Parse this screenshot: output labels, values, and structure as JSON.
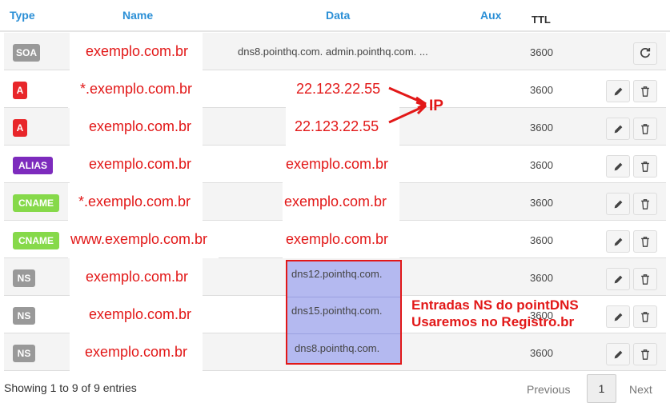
{
  "headers": {
    "type": "Type",
    "name": "Name",
    "data": "Data",
    "aux": "Aux",
    "ttl": "TTL"
  },
  "rows": [
    {
      "type": "SOA",
      "name": "exemplo.com.br",
      "data": "dns8.pointhq.com. admin.pointhq.com. ...",
      "ttl": "3600"
    },
    {
      "type": "A",
      "name": "*.exemplo.com.br",
      "data": "22.123.22.55",
      "ttl": "3600"
    },
    {
      "type": "A",
      "name": "exemplo.com.br",
      "data": "22.123.22.55",
      "ttl": "3600"
    },
    {
      "type": "ALIAS",
      "name": "exemplo.com.br",
      "data": "exemplo.com.br",
      "ttl": "3600"
    },
    {
      "type": "CNAME",
      "name": "*.exemplo.com.br",
      "data": "exemplo.com.br",
      "ttl": "3600"
    },
    {
      "type": "CNAME",
      "name": "www.exemplo.com.br",
      "data": "exemplo.com.br",
      "ttl": "3600"
    },
    {
      "type": "NS",
      "name": "exemplo.com.br",
      "data": "dns12.pointhq.com.",
      "ttl": "3600"
    },
    {
      "type": "NS",
      "name": "exemplo.com.br",
      "data": "dns15.pointhq.com.",
      "ttl": "3600"
    },
    {
      "type": "NS",
      "name": "exemplo.com.br",
      "data": "dns8.pointhq.com.",
      "ttl": "3600"
    }
  ],
  "annotations": {
    "ip": "IP",
    "ns_line1": "Entradas NS do pointDNS",
    "ns_line2": "Usaremos no Registro.br"
  },
  "footer": {
    "info": "Showing 1 to 9 of 9 entries",
    "previous": "Previous",
    "current_page": "1",
    "next": "Next"
  },
  "colors": {
    "header_text": "#2b8fd6",
    "annotation_red": "#e21818",
    "badge_a": "#e8262a",
    "badge_alias": "#7d2bbd",
    "badge_cname": "#86d94a",
    "badge_gray": "#999999",
    "ns_highlight": "#b4b9f0"
  },
  "icons": [
    "refresh-icon",
    "pencil-icon",
    "trash-icon",
    "arrow-icon"
  ]
}
